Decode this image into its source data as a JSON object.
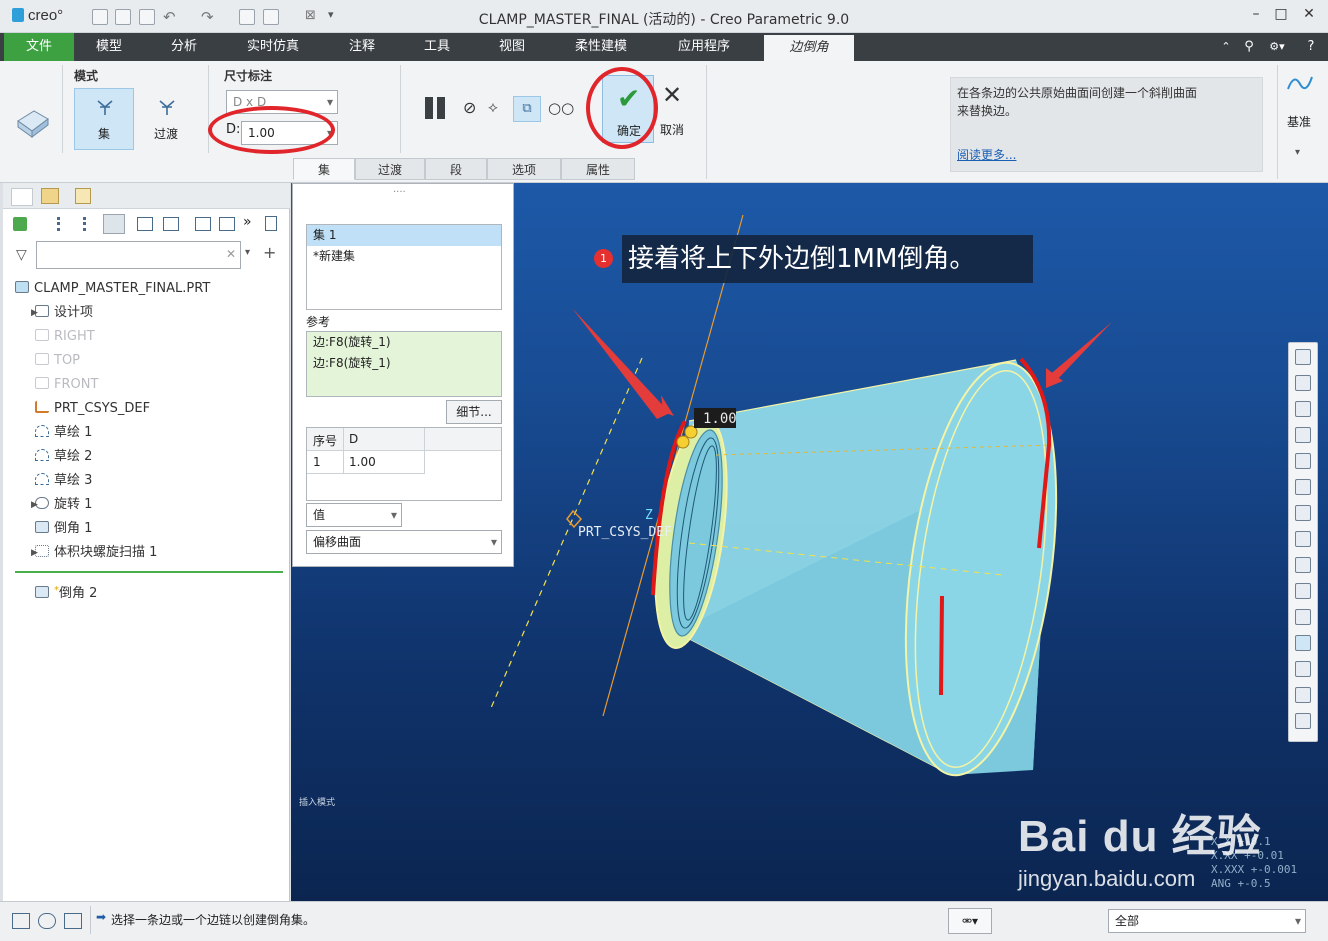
{
  "app": {
    "logo": "creo°",
    "window_title": "CLAMP_MASTER_FINAL (活动的) - Creo Parametric 9.0"
  },
  "menu": {
    "file": "文件",
    "items": [
      "模型",
      "分析",
      "实时仿真",
      "注释",
      "工具",
      "视图",
      "柔性建模",
      "应用程序"
    ],
    "active": "边倒角"
  },
  "ribbon": {
    "mode_label": "模式",
    "set_label": "集",
    "transition_label": "过渡",
    "dim_label": "尺寸标注",
    "dim_scheme": "D x D",
    "d_prefix": "D:",
    "d_value": "1.00",
    "ok_label": "确定",
    "cancel_label": "取消",
    "tabs": [
      "集",
      "过渡",
      "段",
      "选项",
      "属性"
    ],
    "help_text": "在各条边的公共原始曲面间创建一个斜削曲面来替换边。",
    "read_more": "阅读更多...",
    "datum_label": "基准"
  },
  "tree": {
    "search_placeholder": "",
    "root": "CLAMP_MASTER_FINAL.PRT",
    "items": [
      {
        "label": "设计项",
        "dim": false
      },
      {
        "label": "RIGHT",
        "dim": true
      },
      {
        "label": "TOP",
        "dim": true
      },
      {
        "label": "FRONT",
        "dim": true
      },
      {
        "label": "PRT_CSYS_DEF",
        "dim": false
      },
      {
        "label": "草绘 1",
        "dim": false
      },
      {
        "label": "草绘 2",
        "dim": false
      },
      {
        "label": "草绘 3",
        "dim": false
      },
      {
        "label": "旋转 1",
        "dim": false
      },
      {
        "label": "倒角 1",
        "dim": false
      },
      {
        "label": "体积块螺旋扫描 1",
        "dim": false
      }
    ],
    "new_item": "倒角 2"
  },
  "sets_panel": {
    "dots": "....",
    "sets": [
      "集 1",
      "*新建集"
    ],
    "ref_label": "参考",
    "refs": [
      "边:F8(旋转_1)",
      "边:F8(旋转_1)"
    ],
    "details_button": "细节...",
    "table_headers": [
      "序号",
      "D"
    ],
    "table_row": [
      "1",
      "1.00"
    ],
    "value_select": "值",
    "offset_select": "偏移曲面"
  },
  "viewport": {
    "callout_number": "1",
    "callout_text": "接着将上下外边倒1MM倒角。",
    "dim_tag": "1.00",
    "csys_label": "PRT_CSYS_DEF",
    "z_label": "Z",
    "insert_mode": "插入模式",
    "tolerances": [
      "X.X +-0.1",
      "X.XX +-0.01",
      "X.XXX +-0.001",
      "ANG +-0.5"
    ]
  },
  "status": {
    "message": "选择一条边或一个边链以创建倒角集。",
    "filter_value": "全部"
  },
  "watermark": {
    "brand": "Bai du 经验",
    "url": "jingyan.baidu.com"
  }
}
